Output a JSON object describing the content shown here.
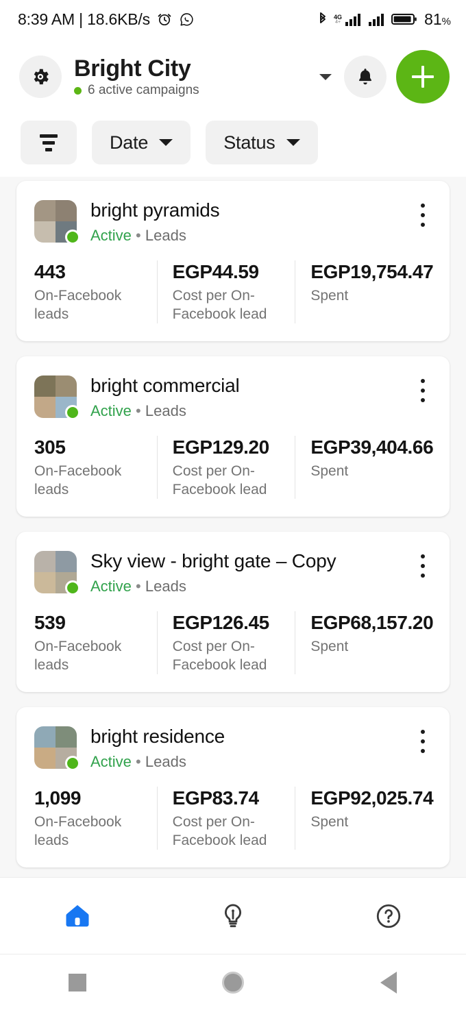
{
  "status_bar": {
    "time_and_net": "8:39 AM | 18.6KB/s",
    "alarm_icon": "alarm-clock-icon",
    "whatsapp_icon": "whatsapp-icon",
    "bluetooth_icon": "bluetooth-icon",
    "network_type": "4G",
    "network_sub": "4+",
    "signal_icon_1": "cellular-signal-icon",
    "signal_icon_2": "cellular-signal-icon",
    "battery_icon": "battery-icon",
    "battery_level": "81",
    "battery_unit": "%"
  },
  "header": {
    "gear_icon": "gear-icon",
    "title": "Bright City",
    "subtitle": "6 active campaigns",
    "status_dot_color": "#5cb615",
    "dropdown_icon": "chevron-down-icon",
    "bell_icon": "bell-icon",
    "fab_icon": "plus-icon",
    "fab_color": "#5cb615"
  },
  "filters": {
    "filter_icon": "filter-icon",
    "chips": [
      {
        "label": "Date",
        "caret": "chevron-down-icon"
      },
      {
        "label": "Status",
        "caret": "chevron-down-icon"
      }
    ]
  },
  "campaigns": [
    {
      "name": "bright pyramids",
      "status": "Active",
      "separator": "•",
      "objective": "Leads",
      "thumb_colors": [
        "#a39684",
        "#8d8172",
        "#c6bdae",
        "#6f7a80"
      ],
      "menu_icon": "more-vertical-icon",
      "metrics": [
        {
          "value": "443",
          "label": "On-Facebook leads"
        },
        {
          "value": "EGP44.59",
          "label": "Cost per On-Facebook lead"
        },
        {
          "value": "EGP19,754.47",
          "label": "Spent"
        }
      ]
    },
    {
      "name": "bright commercial",
      "status": "Active",
      "separator": "•",
      "objective": "Leads",
      "thumb_colors": [
        "#7d7458",
        "#9b8d72",
        "#c2a888",
        "#9ab6c9"
      ],
      "menu_icon": "more-vertical-icon",
      "metrics": [
        {
          "value": "305",
          "label": "On-Facebook leads"
        },
        {
          "value": "EGP129.20",
          "label": "Cost per On-Facebook lead"
        },
        {
          "value": "EGP39,404.66",
          "label": "Spent"
        }
      ]
    },
    {
      "name": "Sky view - bright gate – Copy",
      "status": "Active",
      "separator": "•",
      "objective": "Leads",
      "thumb_colors": [
        "#b9b2a9",
        "#8e9aa3",
        "#cbb99a",
        "#b0a894"
      ],
      "menu_icon": "more-vertical-icon",
      "metrics": [
        {
          "value": "539",
          "label": "On-Facebook leads"
        },
        {
          "value": "EGP126.45",
          "label": "Cost per On-Facebook lead"
        },
        {
          "value": "EGP68,157.20",
          "label": "Spent"
        }
      ]
    },
    {
      "name": "bright residence",
      "status": "Active",
      "separator": "•",
      "objective": "Leads",
      "thumb_colors": [
        "#8fa9b6",
        "#7e8d7a",
        "#c9ab84",
        "#b6ada0"
      ],
      "menu_icon": "more-vertical-icon",
      "metrics": [
        {
          "value": "1,099",
          "label": "On-Facebook leads"
        },
        {
          "value": "EGP83.74",
          "label": "Cost per On-Facebook lead"
        },
        {
          "value": "EGP92,025.74",
          "label": "Spent"
        }
      ]
    }
  ],
  "bottom_nav": {
    "items": [
      {
        "icon": "home-icon",
        "active": true,
        "color": "#1877f2"
      },
      {
        "icon": "lightbulb-icon",
        "active": false,
        "color": "#3a3a3a"
      },
      {
        "icon": "help-circle-icon",
        "active": false,
        "color": "#3a3a3a"
      }
    ]
  },
  "android_nav": {
    "recents_icon": "square-recents-icon",
    "home_icon": "circle-home-icon",
    "back_icon": "triangle-back-icon"
  }
}
